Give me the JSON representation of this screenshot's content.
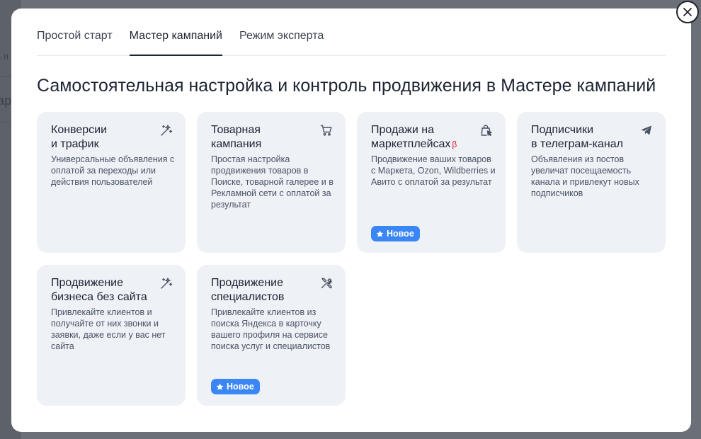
{
  "background": {
    "fragment_1": "а п",
    "fragment_2": "ар"
  },
  "tabs": [
    {
      "label": "Простой старт",
      "active": false
    },
    {
      "label": "Мастер кампаний",
      "active": true
    },
    {
      "label": "Режим эксперта",
      "active": false
    }
  ],
  "heading": "Самостоятельная настройка и контроль продвижения в Мастере кампаний",
  "cards": [
    {
      "title_line1": "Конверсии",
      "title_line2": "и трафик",
      "description": "Универсальные объявления с оплатой за переходы или действия пользователей",
      "icon": "magic-wand-icon"
    },
    {
      "title_line1": "Товарная",
      "title_line2": "кампания",
      "description": "Простая настройка продвижения товаров в Поиске, товарной галерее и в Рекламной сети с оплатой за результат",
      "icon": "cart-icon"
    },
    {
      "title_line1": "Продажи на",
      "title_line2": "маркетплейсах",
      "title_suffix": "β",
      "description": "Продвижение ваших товаров с Маркета, Ozon, Wildberries и Авито с оплатой за результат",
      "icon": "shopping-bag-cursor-icon",
      "badge": "Новое"
    },
    {
      "title_line1": "Подписчики",
      "title_line2": "в телеграм-канал",
      "description": "Объявления из постов увеличат посещаемость канала и привлекут новых подписчиков",
      "icon": "telegram-plane-icon"
    },
    {
      "title_line1": "Продвижение",
      "title_line2": "бизнеса без сайта",
      "description": "Привлекайте клиентов и получайте от них звонки и заявки, даже если у вас нет сайта",
      "icon": "magic-wand-icon"
    },
    {
      "title_line1": "Продвижение",
      "title_line2": "специалистов",
      "description": "Привлекайте клиентов из поиска Яндекса в карточку вашего профиля на сервисе поиска услуг и специалистов",
      "icon": "tools-icon",
      "badge": "Новое"
    }
  ],
  "colors": {
    "overlay": "#6b6f78",
    "card_bg": "#eef1f6",
    "badge_bg": "#3a86f5",
    "beta_mark": "#e0202f",
    "text_primary": "#1d2433"
  }
}
